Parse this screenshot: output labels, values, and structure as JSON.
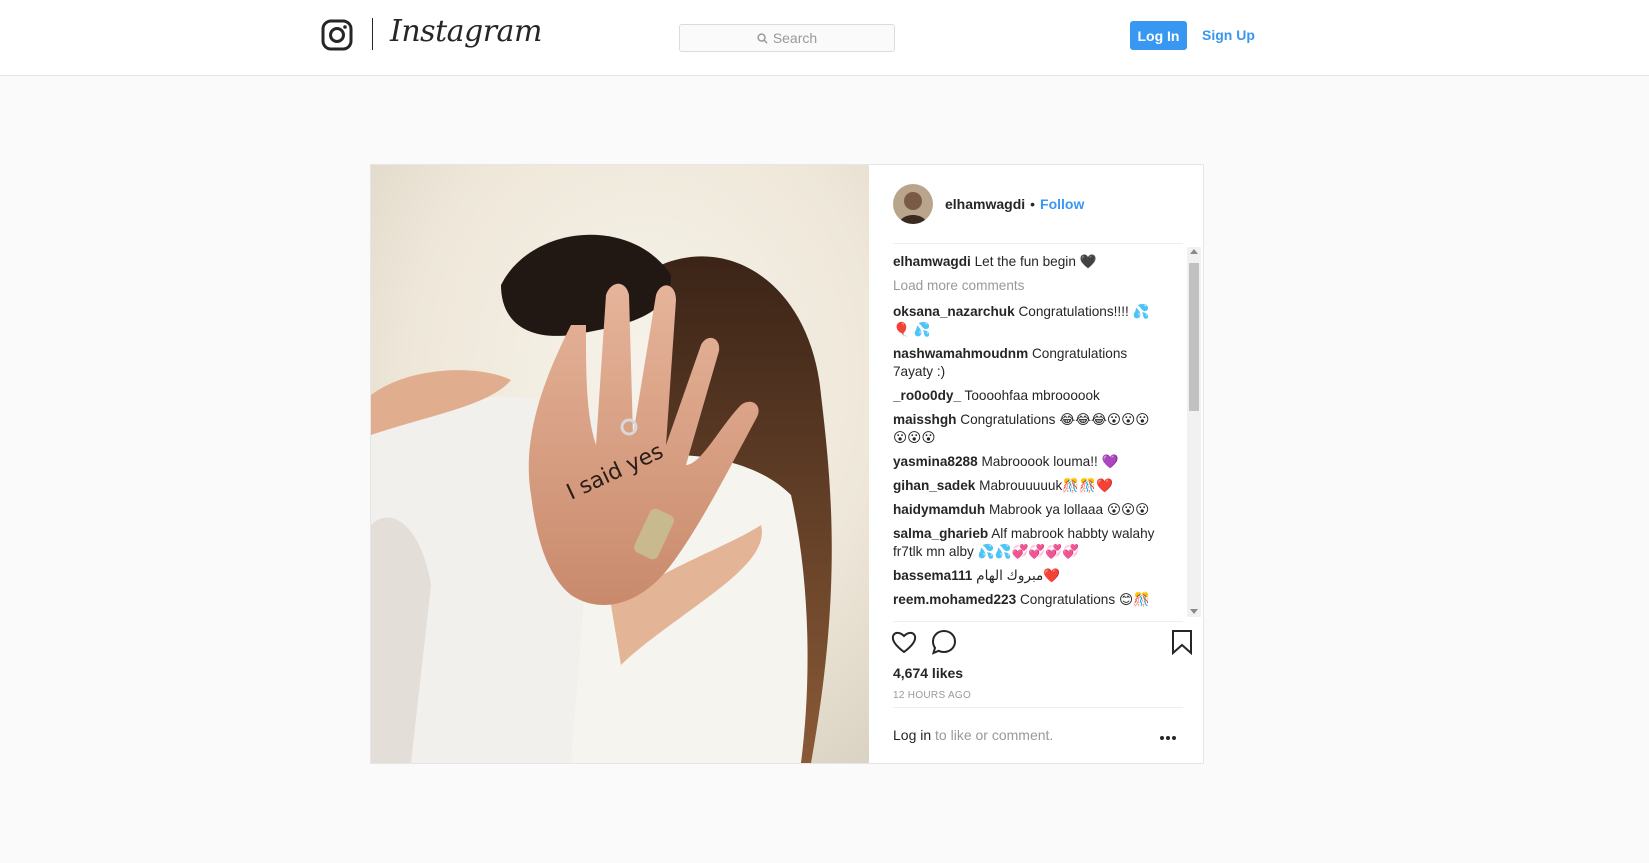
{
  "header": {
    "wordmark": "Instagram",
    "search_placeholder": "Search",
    "login_label": "Log In",
    "signup_label": "Sign Up"
  },
  "post": {
    "username": "elhamwagdi",
    "separator": "•",
    "follow_label": "Follow",
    "hand_text": "I said yes",
    "caption": {
      "user": "elhamwagdi",
      "text": "Let the fun begin 🖤"
    },
    "load_more": "Load more comments",
    "comments": [
      {
        "user": "oksana_nazarchuk",
        "text": "Congratulations!!!! 💦 🎈 💦"
      },
      {
        "user": "nashwamahmoudnm",
        "text": "Congratulations 7ayaty :)"
      },
      {
        "user": "_ro0o0dy_",
        "text": "Toooohfaa mbroooook"
      },
      {
        "user": "maisshgh",
        "text": "Congratulations 😂😂😂😮😮😮😮😮😮"
      },
      {
        "user": "yasmina8288",
        "text": "Mabrooook louma!! 💜"
      },
      {
        "user": "gihan_sadek",
        "text": "Mabrouuuuuk🎊🎊❤️"
      },
      {
        "user": "haidymamduh",
        "text": "Mabrook ya lollaaa 😮😮😮"
      },
      {
        "user": "salma_gharieb",
        "text": "Alf mabrook habbty walahy fr7tlk mn alby 💦💦💞💞💞💞"
      },
      {
        "user": "bassema111",
        "text": "مبروك الهام❤️"
      },
      {
        "user": "reem.mohamed223",
        "text": "Congratulations 😊🎊"
      }
    ],
    "likes": "4,674 likes",
    "time_ago": "12 HOURS AGO",
    "login_link": "Log in",
    "login_suffix": " to like or comment."
  },
  "icons": [
    "instagram-camera-icon",
    "search-icon",
    "heart-icon",
    "comment-icon",
    "bookmark-icon",
    "more-options-icon"
  ]
}
